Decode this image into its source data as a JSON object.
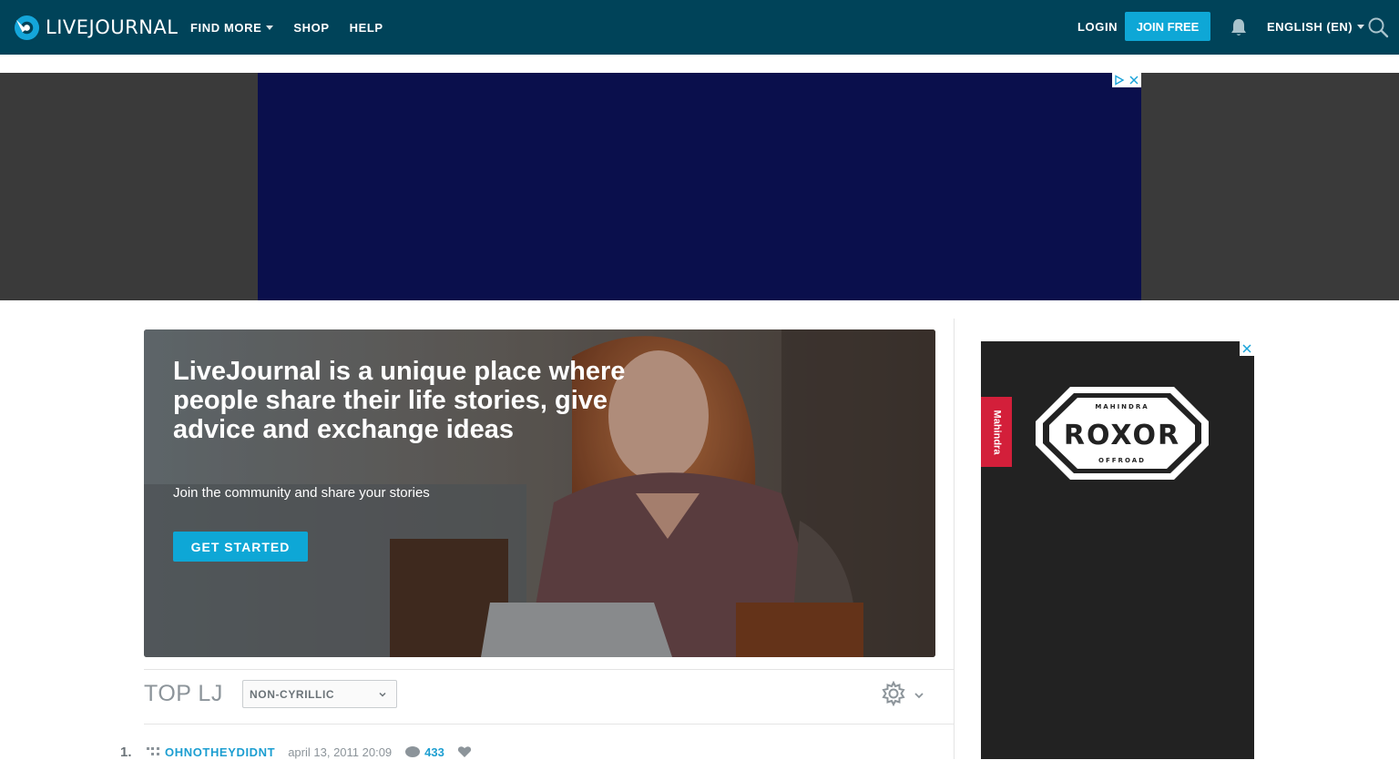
{
  "header": {
    "brand": "LIVEJOURNAL",
    "nav": [
      {
        "label": "FIND MORE",
        "dropdown": true
      },
      {
        "label": "SHOP",
        "dropdown": false
      },
      {
        "label": "HELP",
        "dropdown": false
      }
    ],
    "login_label": "LOGIN",
    "join_label": "JOIN FREE",
    "language_label": "ENGLISH (EN)"
  },
  "hero": {
    "title": "LiveJournal is a unique place where people share their life stories, give advice and exchange ideas",
    "subtitle": "Join the community and share your stories",
    "cta_label": "GET STARTED"
  },
  "top_lj": {
    "title": "TOP LJ",
    "filter_selected": "NON-CYRILLIC",
    "posts": [
      {
        "rank": "1.",
        "user": "OHNOTHEYDIDNT",
        "date": "april 13, 2011 20:09",
        "comments": "433"
      }
    ]
  },
  "side_ad": {
    "brand_tab": "Mahindra",
    "logo_top": "MAHINDRA",
    "logo_main": "ROXOR",
    "logo_bottom": "OFFROAD"
  },
  "colors": {
    "header_bg": "#004359",
    "accent": "#0ea7d6",
    "link": "#1c9ed1",
    "ad_banner": "#0a0f4c"
  },
  "icons": [
    "livejournal-logo-icon",
    "caret-down-icon",
    "bell-icon",
    "search-icon",
    "adchoices-icon",
    "close-icon",
    "chevron-down-icon",
    "gear-icon",
    "community-icon",
    "comment-icon",
    "heart-icon"
  ]
}
